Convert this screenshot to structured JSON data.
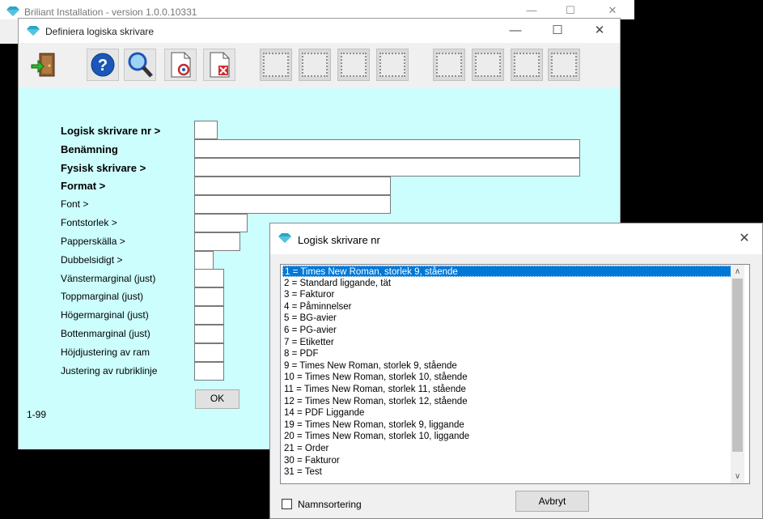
{
  "background_window": {
    "title": "Briliant Installation  -  version 1.0.0.10331",
    "minimize": "—",
    "maximize": "☐",
    "close": "✕"
  },
  "define_window": {
    "title": "Definiera logiska skrivare",
    "minimize": "—",
    "maximize": "☐",
    "close": "✕",
    "toolbar": {
      "exit_icon": "door-exit-icon",
      "help_icon": "help-icon",
      "search_icon": "magnifier-icon",
      "new_doc_icon": "document-refresh-icon",
      "delete_doc_icon": "document-delete-icon",
      "blank_buttons": 7
    },
    "fields": [
      {
        "label": "Logisk skrivare nr >",
        "bold": true,
        "value": ""
      },
      {
        "label": "Benämning",
        "bold": true,
        "value": ""
      },
      {
        "label": "Fysisk skrivare >",
        "bold": true,
        "value": ""
      },
      {
        "label": "Format >",
        "bold": true,
        "value": ""
      },
      {
        "label": "Font >",
        "bold": false,
        "value": ""
      },
      {
        "label": "Fontstorlek >",
        "bold": false,
        "value": ""
      },
      {
        "label": "Papperskälla >",
        "bold": false,
        "value": ""
      },
      {
        "label": "Dubbelsidigt >",
        "bold": false,
        "value": ""
      },
      {
        "label": "Vänstermarginal (just)",
        "bold": false,
        "value": ""
      },
      {
        "label": "Toppmarginal (just)",
        "bold": false,
        "value": ""
      },
      {
        "label": "Högermarginal (just)",
        "bold": false,
        "value": ""
      },
      {
        "label": "Bottenmarginal (just)",
        "bold": false,
        "value": ""
      },
      {
        "label": "Höjdjustering av ram",
        "bold": false,
        "value": ""
      },
      {
        "label": "Justering av rubriklinje",
        "bold": false,
        "value": ""
      }
    ],
    "ok_label": "OK",
    "range_hint": "1-99"
  },
  "dialog": {
    "title": "Logisk skrivare nr",
    "close": "✕",
    "items": [
      "1 = Times New Roman, storlek 9, stående",
      "2 = Standard liggande, tät",
      "3 = Fakturor",
      "4 = Påminnelser",
      "5 = BG-avier",
      "6 = PG-avier",
      "7 = Etiketter",
      "8 = PDF",
      "9 = Times New Roman, storlek 9, stående",
      "10 = Times New Roman, storlek 10, stående",
      "11 = Times New Roman, storlek 11, stående",
      "12 = Times New Roman, storlek 12, stående",
      "14 = PDF Liggande",
      "19 = Times New Roman, storlek 9, liggande",
      "20 = Times New Roman, storlek 10, liggande",
      "21 = Order",
      "30 = Fakturor",
      "31 = Test"
    ],
    "selected_index": 0,
    "scroll_up": "∧",
    "scroll_down": "∨",
    "checkbox_label": "Namnsortering",
    "checkbox_checked": false,
    "cancel_label": "Avbryt"
  },
  "colors": {
    "client_bg": "#ccfefe",
    "selection": "#0078d7",
    "gem": "#2aa6c8"
  }
}
